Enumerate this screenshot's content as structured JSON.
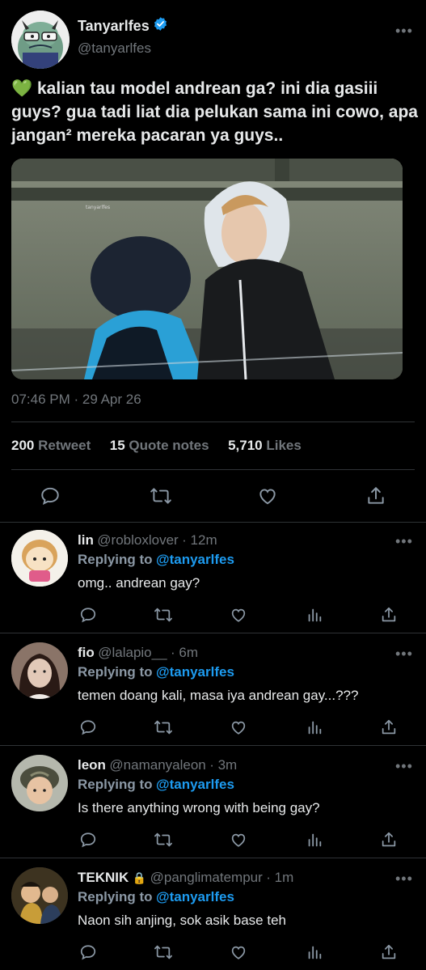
{
  "tweet": {
    "display_name": "Tanyarlfes",
    "handle": "@tanyarlfes",
    "more": "•••",
    "emoji": "💚",
    "text": "kalian tau model andrean ga? ini dia gasiii guys? gua tadi liat dia pelukan sama ini cowo, apa jangan² mereka pacaran ya guys..",
    "photo_watermark": "tanyarlfes",
    "time": "07:46 PM · 29 Apr 26",
    "stats": {
      "retweets_count": "200",
      "retweets_label": "Retweet",
      "quotes_count": "15",
      "quotes_label": "Quote notes",
      "likes_count": "5,710",
      "likes_label": "Likes"
    },
    "actions": [
      "reply-icon",
      "retweet-icon",
      "like-icon",
      "share-icon"
    ]
  },
  "replies": [
    {
      "name": "lin",
      "handle": "@robloxlover",
      "time": "· 12m",
      "replying_label": "Replying to",
      "replying_to": "@tanyarlfes",
      "text": "omg.. andrean gay?",
      "avatar_colors": [
        "#f2e4cc",
        "#e05c8a"
      ]
    },
    {
      "name": "fio",
      "handle": "@lalapio__",
      "time": "· 6m",
      "replying_label": "Replying to",
      "replying_to": "@tanyarlfes",
      "text": "temen doang kali, masa iya andrean gay...???",
      "avatar_colors": [
        "#d9c2b5",
        "#3a2620"
      ]
    },
    {
      "name": "leon",
      "handle": "@namanyaleon",
      "time": "· 3m",
      "replying_label": "Replying to",
      "replying_to": "@tanyarlfes",
      "text": "Is there anything wrong with being gay?",
      "avatar_colors": [
        "#a9b0a0",
        "#4a4c3c"
      ]
    },
    {
      "name": "TEKNIK",
      "lock": "🔒",
      "handle": "@panglimatempur",
      "time": "· 1m",
      "replying_label": "Replying to",
      "replying_to": "@tanyarlfes",
      "text": "Naon sih anjing, sok asik base teh",
      "avatar_colors": [
        "#6b5324",
        "#c89d38"
      ]
    }
  ],
  "colors": {
    "background": "#000000",
    "text": "#e7e9ea",
    "muted": "#71767b",
    "accent": "#1d9bf0",
    "verified": "#1d9bf0",
    "divider": "#2f3336"
  }
}
